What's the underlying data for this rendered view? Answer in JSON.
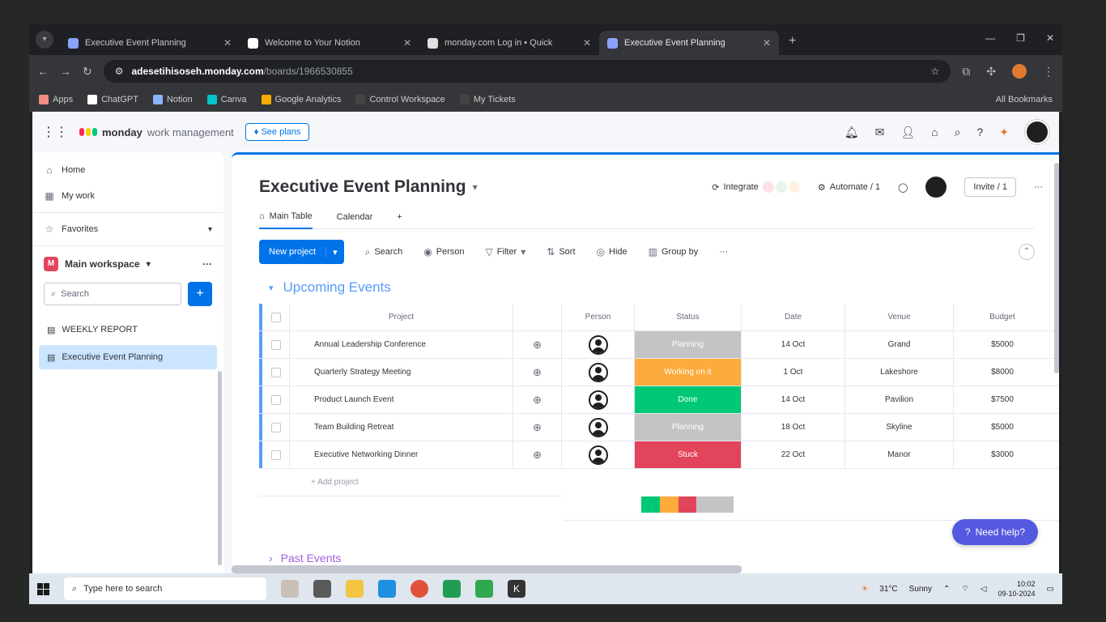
{
  "browser": {
    "tabs": [
      {
        "title": "Executive Event Planning",
        "active": false
      },
      {
        "title": "Welcome to Your Notion",
        "active": false
      },
      {
        "title": "monday.com Log in • Quick",
        "active": false
      },
      {
        "title": "Executive Event Planning",
        "active": true
      }
    ],
    "url_site": "adesetihisoseh.monday.com",
    "url_path": "/boards/1966530855",
    "bookmarks": [
      "Apps",
      "ChatGPT",
      "Notion",
      "Canva",
      "Google Analytics",
      "Control Workspace",
      "My Tickets"
    ],
    "bookmarks_right": "All Bookmarks"
  },
  "app": {
    "logo_text": "monday",
    "logo_sub": "work management",
    "see_plans": "See plans",
    "colors": {
      "accent": "#0073ea",
      "group": "#579bfc"
    }
  },
  "sidebar": {
    "home": "Home",
    "my_work": "My work",
    "favorites": "Favorites",
    "workspace": "Main workspace",
    "search_placeholder": "Search",
    "boards": [
      "WEEKLY REPORT",
      "Executive Event Planning"
    ]
  },
  "board": {
    "title": "Executive Event Planning",
    "integrate": "Integrate",
    "automate": "Automate / 1",
    "invite": "Invite / 1",
    "views": [
      "Main Table",
      "Calendar"
    ],
    "new_button": "New project",
    "actions": [
      "Search",
      "Person",
      "Filter",
      "Sort",
      "Hide",
      "Group by"
    ],
    "group_title": "Upcoming Events",
    "columns": [
      "Project",
      "Person",
      "Status",
      "Date",
      "Venue",
      "Budget"
    ],
    "rows": [
      {
        "project": "Annual Leadership Conference",
        "status": "Planning",
        "status_color": "#c4c4c4",
        "date": "14 Oct",
        "venue": "Grand",
        "budget": "$5000"
      },
      {
        "project": "Quarterly Strategy Meeting",
        "status": "Working on it",
        "status_color": "#fdab3d",
        "date": "1 Oct",
        "venue": "Lakeshore",
        "budget": "$8000"
      },
      {
        "project": "Product Launch Event",
        "status": "Done",
        "status_color": "#00c875",
        "date": "14 Oct",
        "venue": "Pavilion",
        "budget": "$7500"
      },
      {
        "project": "Team Building Retreat",
        "status": "Planning",
        "status_color": "#c4c4c4",
        "date": "18 Oct",
        "venue": "Skyline",
        "budget": "$5000"
      },
      {
        "project": "Executive Networking Dinner",
        "status": "Stuck",
        "status_color": "#e2445c",
        "date": "22 Oct",
        "venue": "Manor",
        "budget": "$3000"
      }
    ],
    "add_item": "+ Add project",
    "status_summary": [
      {
        "color": "#00c875",
        "share": 0.2
      },
      {
        "color": "#fdab3d",
        "share": 0.2
      },
      {
        "color": "#e2445c",
        "share": 0.2
      },
      {
        "color": "#c4c4c4",
        "share": 0.4
      }
    ],
    "help": "Need help?",
    "past_group": "Past Events"
  },
  "taskbar": {
    "search_placeholder": "Type here to search",
    "weather": "31°C",
    "weather_desc": "Sunny",
    "time": "10:02",
    "date": "09-10-2024"
  }
}
